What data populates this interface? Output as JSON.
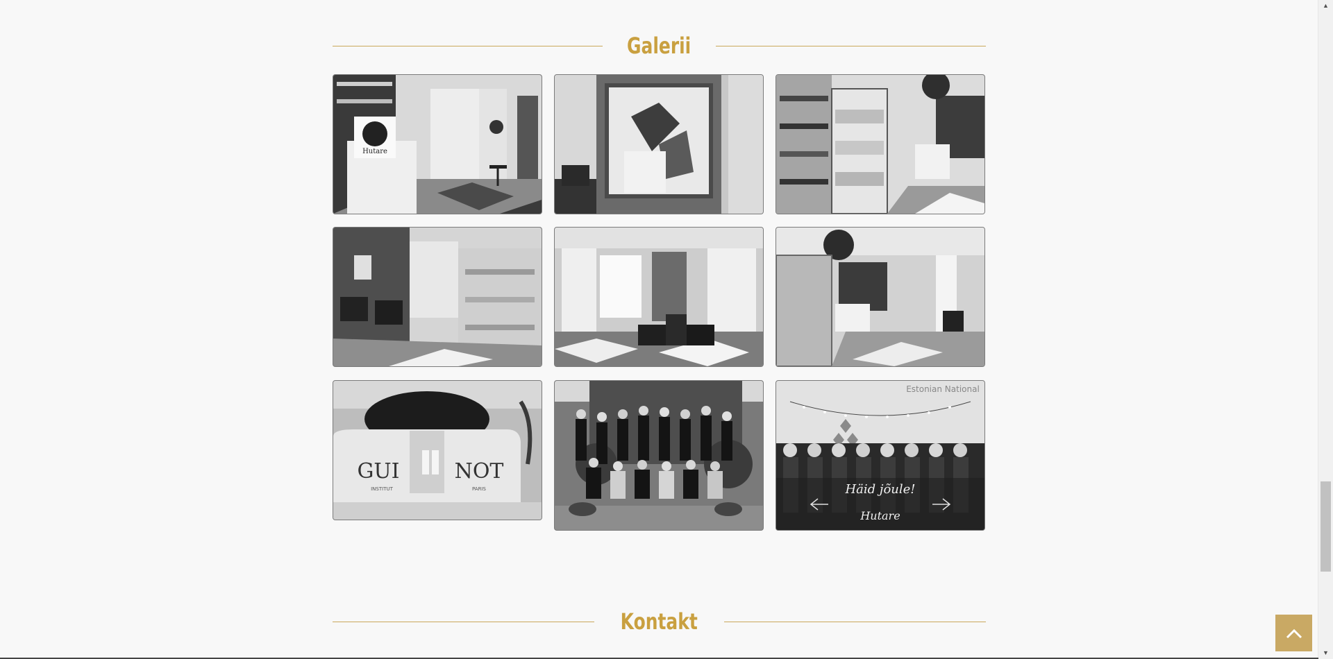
{
  "gallery": {
    "title": "Galerii",
    "images": [
      {
        "name": "salon-reception-photo"
      },
      {
        "name": "salon-mirror-photo"
      },
      {
        "name": "salon-product-shelves-photo"
      },
      {
        "name": "salon-wash-area-photo"
      },
      {
        "name": "salon-styling-chairs-photo"
      },
      {
        "name": "salon-interior-wide-photo"
      },
      {
        "name": "guinot-device-photo"
      },
      {
        "name": "staff-group-garden-photo"
      },
      {
        "name": "christmas-greeting-photo"
      }
    ]
  },
  "guinot_text": {
    "brand_left": "GUI",
    "brand_right": "NOT",
    "sub_left": "INSTITUT",
    "sub_right": "PARIS"
  },
  "christmas_card": {
    "banner": "Estonian National",
    "greeting": "Häid jõule!",
    "signature": "Hutare"
  },
  "reception_sign": {
    "text": "Hutare"
  },
  "contact": {
    "title": "Kontakt"
  },
  "scrollbar": {
    "up_icon": "▲",
    "down_icon": "▼"
  },
  "back_to_top": {
    "icon": "chevron-up-icon"
  },
  "colors": {
    "accent": "#c9a040",
    "rule": "#c9a85a",
    "back_to_top_bg": "#c9a964",
    "background": "#f8f8f8"
  }
}
